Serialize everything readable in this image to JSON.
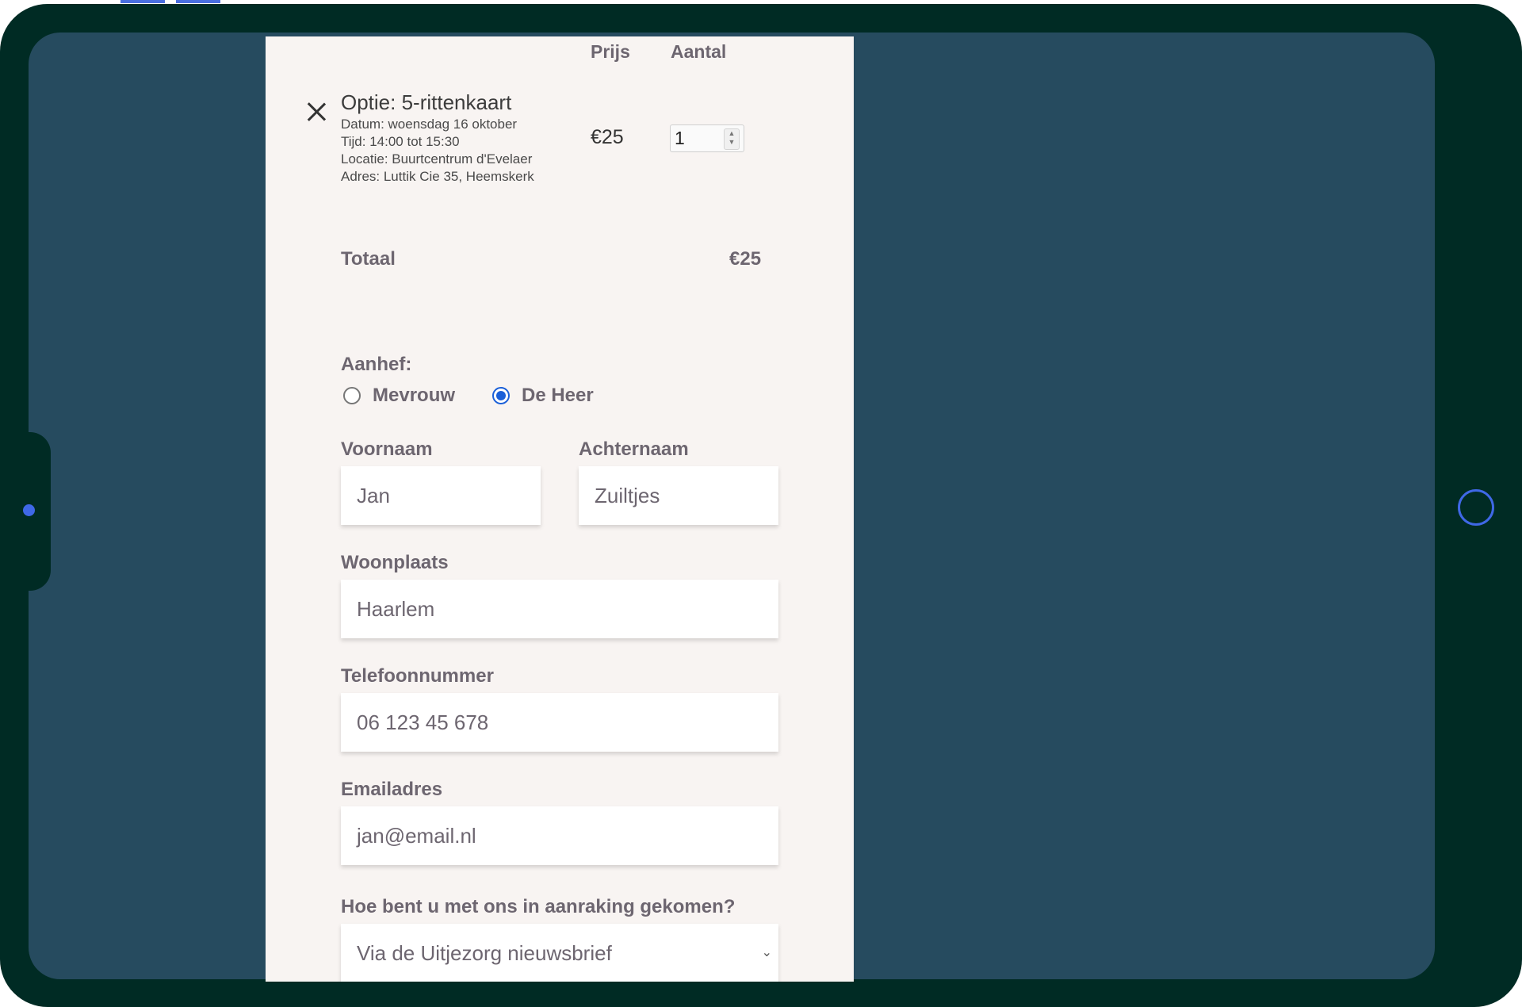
{
  "cart": {
    "headers": {
      "price": "Prijs",
      "quantity": "Aantal"
    },
    "item": {
      "title": "Optie: 5-rittenkaart",
      "date": "Datum: woensdag 16 oktober",
      "time": "Tijd: 14:00 tot 15:30",
      "location": "Locatie: Buurtcentrum d'Evelaer",
      "address": "Adres: Luttik Cie 35, Heemskerk",
      "price": "€25",
      "quantity": "1"
    },
    "total_label": "Totaal",
    "total_value": "€25"
  },
  "form": {
    "salutation": {
      "label": "Aanhef:",
      "options": [
        "Mevrouw",
        "De Heer"
      ],
      "selected": "De Heer"
    },
    "first_name": {
      "label": "Voornaam",
      "value": "Jan"
    },
    "last_name": {
      "label": "Achternaam",
      "value": "Zuiltjes"
    },
    "city": {
      "label": "Woonplaats",
      "value": "Haarlem"
    },
    "phone": {
      "label": "Telefoonnummer",
      "value": "06 123 45 678"
    },
    "email": {
      "label": "Emailadres",
      "value": "jan@email.nl"
    },
    "referral": {
      "label": "Hoe bent u met ons in aanraking gekomen?",
      "value": "Via de Uitjezorg nieuwsbrief"
    }
  },
  "colors": {
    "device_frame": "#002b24",
    "screen": "#264b5f",
    "panel": "#f8f4f2",
    "accent": "#3f68e6",
    "radio_selected": "#1a5fd8",
    "text": "#6d6670"
  },
  "icons": [
    "close-icon",
    "stepper-arrows-icon",
    "chevron-down-icon",
    "camera-dot-icon",
    "home-button-icon"
  ]
}
